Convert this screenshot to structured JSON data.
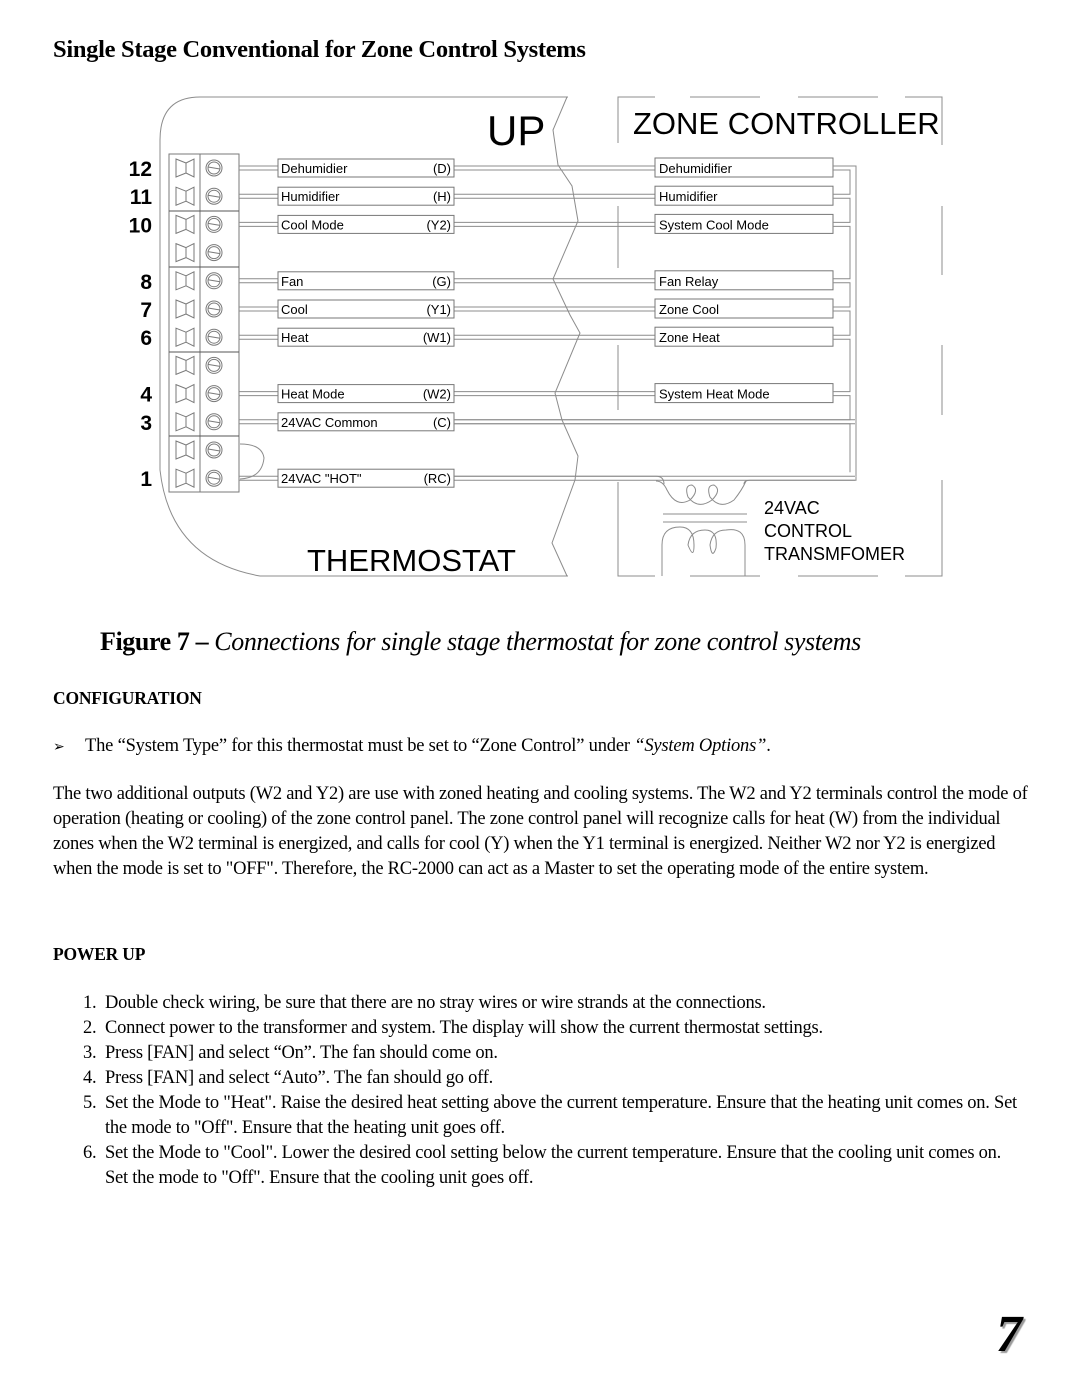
{
  "section_title": "Single Stage Conventional for Zone Control Systems",
  "diagram": {
    "up_label": "UP",
    "zone_controller_label": "ZONE CONTROLLER",
    "thermostat_label": "THERMOSTAT",
    "transformer_label": [
      "24VAC",
      "CONTROL",
      "TRANSMFOMER"
    ],
    "terminal_numbers": [
      "12",
      "11",
      "10",
      "",
      "8",
      "7",
      "6",
      "",
      "4",
      "3",
      "",
      "1"
    ],
    "thermostat_terminals": [
      {
        "label": "Dehumidier",
        "code": "(D)"
      },
      {
        "label": "Humidifier",
        "code": "(H)"
      },
      {
        "label": "Cool Mode",
        "code": "(Y2)"
      },
      {
        "label": "",
        "code": ""
      },
      {
        "label": "Fan",
        "code": "(G)"
      },
      {
        "label": "Cool",
        "code": "(Y1)"
      },
      {
        "label": "Heat",
        "code": "(W1)"
      },
      {
        "label": "",
        "code": ""
      },
      {
        "label": "Heat Mode",
        "code": "(W2)"
      },
      {
        "label": "24VAC Common",
        "code": "(C)"
      },
      {
        "label": "",
        "code": ""
      },
      {
        "label": "24VAC \"HOT\"",
        "code": "(RC)"
      }
    ],
    "zone_terminals": [
      "Dehumidifier",
      "Humidifier",
      "System Cool Mode",
      "",
      "Fan Relay",
      "Zone Cool",
      "Zone Heat",
      "",
      "System Heat Mode",
      "",
      "",
      ""
    ]
  },
  "caption": {
    "figure": "Figure 7 – ",
    "description": "Connections for single stage thermostat for zone control systems"
  },
  "configuration": {
    "heading": "CONFIGURATION",
    "bullet_arrow": "➢",
    "bullet_text": "The “System Type” for this thermostat must be set to “Zone Control” under ",
    "bullet_italic": "“System Options”",
    "bullet_end": ".",
    "paragraph": "The two additional outputs (W2 and Y2) are use with zoned heating and cooling systems.  The W2 and Y2 terminals control the mode of operation (heating or cooling) of the zone control panel.  The zone control panel will recognize calls for heat (W) from the individual zones when the W2 terminal is energized, and calls for cool (Y) when the Y1 terminal is energized.  Neither W2 nor Y2 is energized when the mode is set to \"OFF\".  Therefore, the RC-2000 can act as a Master to set the operating mode of the entire system."
  },
  "power_up": {
    "heading": "POWER UP",
    "steps": [
      {
        "num": "1.",
        "text": "Double check wiring, be sure that there are no stray wires or wire strands at the connections."
      },
      {
        "num": "2.",
        "text": "Connect power to the transformer and system.  The display will show the current thermostat settings."
      },
      {
        "num": "3.",
        "text": "Press [FAN] and select “On”.  The fan should come on."
      },
      {
        "num": "4.",
        "text": "Press [FAN] and select “Auto”.  The fan should go off."
      },
      {
        "num": "5.",
        "text": "Set the Mode to \"Heat\".  Raise the desired heat setting above the current temperature.  Ensure that the heating unit comes on.  Set the mode to \"Off\".  Ensure that the heating unit goes off."
      },
      {
        "num": "6.",
        "text": "Set the Mode to \"Cool\".  Lower the desired cool setting below the current temperature.  Ensure that the cooling unit comes on.  Set the mode to \"Off\".  Ensure that the cooling unit goes off."
      }
    ]
  },
  "page_number": "7"
}
